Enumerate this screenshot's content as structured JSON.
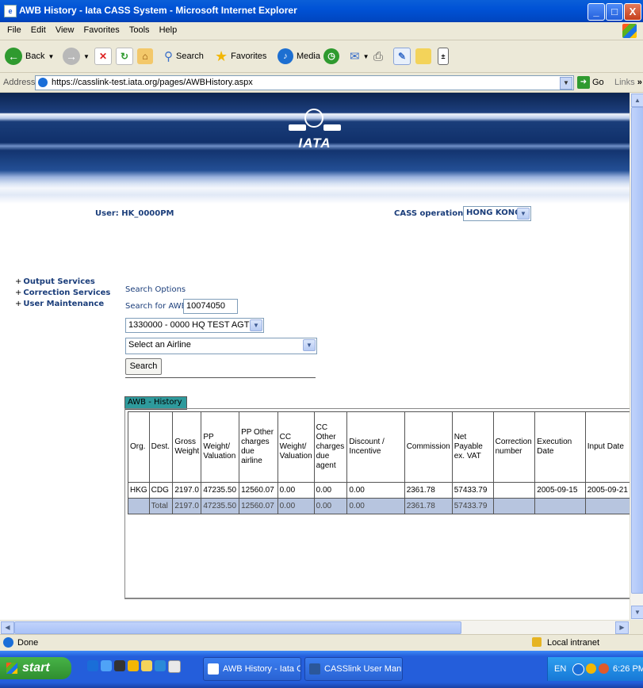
{
  "window": {
    "title": "AWB History - Iata CASS System - Microsoft Internet Explorer",
    "minimize": "_",
    "maximize": "□",
    "close": "X"
  },
  "menu": [
    "File",
    "Edit",
    "View",
    "Favorites",
    "Tools",
    "Help"
  ],
  "toolbar": {
    "back_label": "Back",
    "search_label": "Search",
    "favorites_label": "Favorites",
    "media_label": "Media"
  },
  "address": {
    "label": "Address",
    "url": "https://casslink-test.iata.org/pages/AWBHistory.aspx",
    "go_label": "Go",
    "links_label": "Links",
    "links_chevron": "»"
  },
  "banner": {
    "logo_text": "IATA"
  },
  "header": {
    "user_label": "User: HK_0000PM",
    "cass_label": "CASS operation:",
    "cass_value": "HONG KONG"
  },
  "nav": {
    "items": [
      {
        "plus": "+",
        "label": "Output Services"
      },
      {
        "plus": "+",
        "label": "Correction Services"
      },
      {
        "plus": "+",
        "label": "User Maintenance"
      }
    ]
  },
  "search": {
    "options_label": "Search Options",
    "awb_label": "Search for AWB",
    "awb_value": "10074050",
    "agent_value": "1330000 - 0000 HQ TEST AGT",
    "airline_value": "Select an Airline",
    "button_label": "Search"
  },
  "history": {
    "title": "AWB - History",
    "columns": [
      "Org.",
      "Dest.",
      "Gross Weight",
      "PP Weight/ Valuation",
      "PP Other charges due airline",
      "CC Weight/ Valuation",
      "CC Other charges due agent",
      "Discount / Incentive",
      "Commission",
      "Net Payable ex. VAT",
      "Correction number",
      "Execution Date",
      "Input Date"
    ],
    "rows": [
      [
        "HKG",
        "CDG",
        "2197.0",
        "47235.50",
        "12560.07",
        "0.00",
        "0.00",
        "0.00",
        "2361.78",
        "57433.79",
        "",
        "2005-09-15",
        "2005-09-21"
      ]
    ],
    "total_row": [
      "",
      "Total",
      "2197.0",
      "47235.50",
      "12560.07",
      "0.00",
      "0.00",
      "0.00",
      "2361.78",
      "57433.79",
      "",
      "",
      ""
    ]
  },
  "status": {
    "text": "Done",
    "zone": "Local intranet"
  },
  "taskbar": {
    "start_label": "start",
    "items": [
      "AWB History - Iata C...",
      "CASSlink User Manual..."
    ],
    "language": "EN",
    "clock": "6:26 PM"
  },
  "colors": {
    "title_bar": "#0A5FD8",
    "label_blue": "#1a3d7a",
    "history_header": "#2e9a9c",
    "total_row": "#b7c5df"
  }
}
